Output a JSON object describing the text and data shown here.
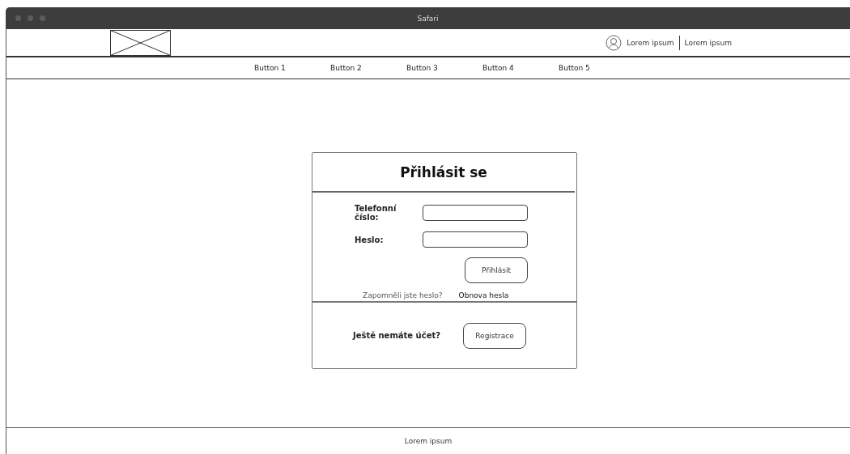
{
  "window": {
    "title": "Safari"
  },
  "header": {
    "user_links": [
      "Lorem ipsum",
      "Lorem ipsum"
    ]
  },
  "nav": [
    "Button 1",
    "Button 2",
    "Button 3",
    "Button 4",
    "Button 5"
  ],
  "login": {
    "title": "Přihlásit se",
    "fields": [
      {
        "label": "Telefonní číslo:"
      },
      {
        "label": "Heslo:"
      }
    ],
    "submit": "Přihlásit",
    "forgot_text": "Zapomněli jste heslo?",
    "forgot_link": "Obnova hesla",
    "register_prompt": "Ještě nemáte účet?",
    "register_button": "Registrace"
  },
  "footer": "Lorem ipsum"
}
